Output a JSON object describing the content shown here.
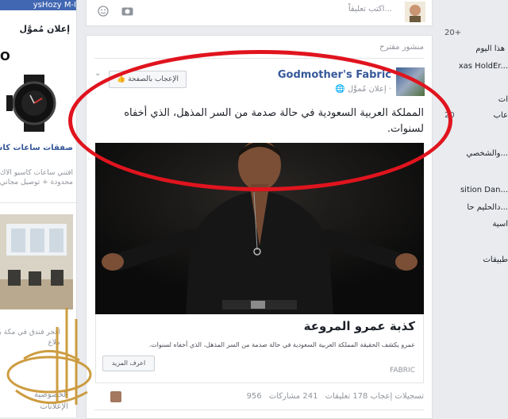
{
  "left": {
    "profile_bar": "ysHozy M-I",
    "ads_title": "إعلان مُموَّل",
    "brand_text": "O",
    "ad_link": "صفقات ساعات كاسيو ال",
    "ad_desc_line1": "اقتني ساعات كاسيو الاك",
    "ad_desc_line2": "محدودة + توصيل مجاني",
    "ad2_line1": "افخر فندق في مكة بتطام عالم",
    "ad2_line2": "ملاع",
    "footer1": "الخصوصية",
    "footer2": "الإعلانات"
  },
  "composer": {
    "placeholder": "اكتب تعليقاً..."
  },
  "post": {
    "suggested_label": "منشور مقترح",
    "page_name": "Godmother's Fabric",
    "sponsored_label": "إعلان مُموَّل ·",
    "like_page_button": "الإعجاب بالصفحة",
    "text": "المملكة العربية السعودية في حالة صدمة من السر المذهل، الذي أخفاه لسنوات.",
    "link_title": "كذبة عمرو المروعة",
    "link_description": "عمرو يكشف الحقيقة المملكة العربية السعودية في حالة صدمة من السر المذهل، الذي أخفاه لسنوات.",
    "learn_more_button": "اعرف المزيد",
    "domain": "FABRIC",
    "stats": {
      "likes": "956 تسجيلات إعجاب",
      "comments": "178 تعليقات",
      "shares": "241 مشاركات"
    }
  },
  "right": {
    "num1": "20+",
    "item1": "هذا اليوم",
    "item2": "xas HoldEr...",
    "item3": "ات",
    "num2": "20",
    "item4": "عاب",
    "item5": "والشخصي...",
    "item6": "sition Dan...",
    "item7": "دالحليم حا...",
    "item8": "اسية",
    "item9": "طبيقات"
  },
  "colors": {
    "fb_blue": "#4267b2",
    "link_blue": "#365899",
    "highlight_ring": "#e0141e"
  }
}
